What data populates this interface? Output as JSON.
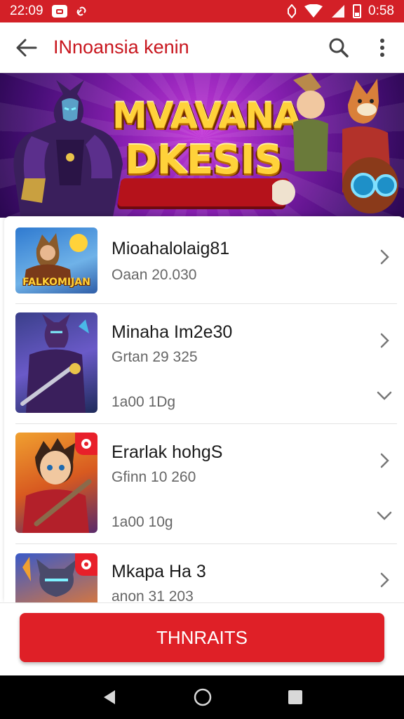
{
  "status_bar": {
    "time": "22:09",
    "right_time": "0:58",
    "icons": [
      "notification-icon",
      "link-icon",
      "alarm-icon",
      "wifi-icon",
      "signal-icon",
      "battery-icon"
    ]
  },
  "app_bar": {
    "title": "INnoansia kenin",
    "back_icon": "arrow-left-icon",
    "search_icon": "search-icon",
    "menu_icon": "more-vert-icon"
  },
  "banner": {
    "line1": "MVAVANA",
    "line2": "DKESIS"
  },
  "list": [
    {
      "name": "Mioahalolaig81",
      "sub": "Oaan 20.030",
      "meta": "",
      "thumb_text": "FALKOMIJAN",
      "badge": false,
      "expand": false
    },
    {
      "name": "Minaha Im2e30",
      "sub": "Grtan 29 325",
      "meta": "1a00 1Dg",
      "thumb_text": "",
      "badge": false,
      "expand": true
    },
    {
      "name": "Erarlak hohgS",
      "sub": "Gfinn 10 260",
      "meta": "1a00 10g",
      "thumb_text": "",
      "badge": true,
      "expand": true
    },
    {
      "name": "Mkapa Ha 3",
      "sub": "anon 31 203",
      "meta": "",
      "thumb_text": "",
      "badge": true,
      "expand": false
    }
  ],
  "cta": {
    "label": "THNRAITS"
  },
  "colors": {
    "accent": "#d32027",
    "banner_purple": "#8a20b3",
    "title_gold": "#ffd23a"
  },
  "nav": {
    "icons": [
      "back-triangle-icon",
      "home-circle-icon",
      "recents-square-icon"
    ]
  }
}
